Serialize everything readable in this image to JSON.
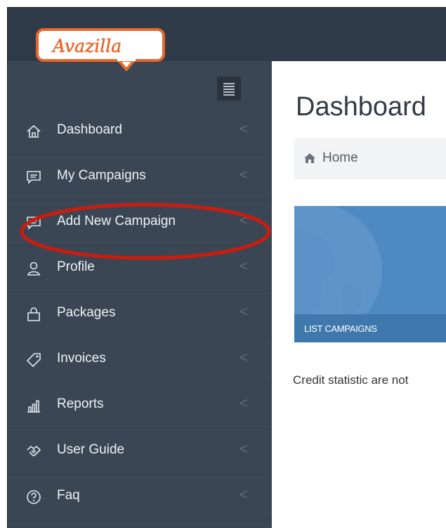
{
  "brand": {
    "logo_text": "Avazilla",
    "accent": "#e8662a"
  },
  "sidebar": {
    "toggle_icon": "hamburger-icon",
    "items": [
      {
        "label": "Dashboard",
        "icon": "home-icon"
      },
      {
        "label": "My Campaigns",
        "icon": "comment-icon"
      },
      {
        "label": "Add New Campaign",
        "icon": "comment-icon"
      },
      {
        "label": "Profile",
        "icon": "user-icon"
      },
      {
        "label": "Packages",
        "icon": "bag-icon"
      },
      {
        "label": "Invoices",
        "icon": "tag-icon"
      },
      {
        "label": "Reports",
        "icon": "bar-chart-icon"
      },
      {
        "label": "User Guide",
        "icon": "handshake-icon"
      },
      {
        "label": "Faq",
        "icon": "question-circle-icon"
      }
    ],
    "chevron": "<"
  },
  "main": {
    "title": "Dashboard",
    "breadcrumb": {
      "home_label": "Home",
      "icon": "home-icon"
    },
    "tile": {
      "label": "LIST CAMPAIGNS",
      "color": "#4e8ac2"
    },
    "credit_text": "Credit statistic are not"
  },
  "annotation": {
    "color": "#cc1c0e"
  }
}
